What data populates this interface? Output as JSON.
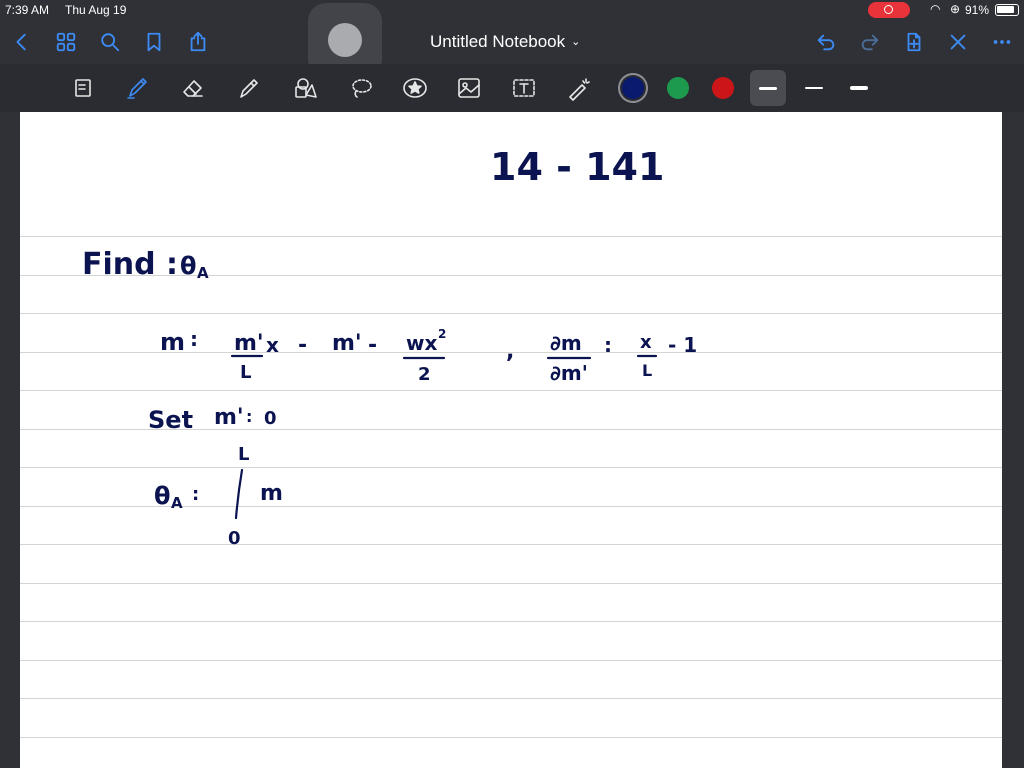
{
  "status": {
    "time": "7:39 AM",
    "date": "Thu Aug 19",
    "battery": "91%"
  },
  "nav": {
    "title": "Untitled Notebook"
  },
  "toolbar": {
    "tools": [
      "page-thumbnail",
      "pen",
      "eraser",
      "highlighter",
      "shapes",
      "lasso",
      "sticker",
      "image",
      "text",
      "laser-pointer"
    ],
    "active_tool": "pen",
    "colors": [
      "#0a1a6e",
      "#1e9a4f",
      "#cc1518"
    ],
    "selected_color": "#0a1a6e",
    "thickness_selected": "thin"
  },
  "notes": {
    "title": "14 - 141",
    "find_label": "Find :",
    "theta": "θ",
    "sub_a": "A",
    "m": "m",
    "eq": ":",
    "m_prime": "m'",
    "l": "L",
    "x": "x",
    "minus": "-",
    "wx": "wx",
    "sq": "2",
    "two": "2",
    "comma": ",",
    "dm": "∂m",
    "dm_prime": "∂m'",
    "minus_one": "- 1",
    "set_label": "Set",
    "zero": "0",
    "integral": "∫",
    "upper": "L",
    "lower": "0"
  }
}
